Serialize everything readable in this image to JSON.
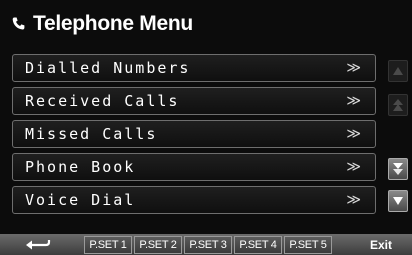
{
  "header": {
    "icon": "phone-icon",
    "title": "Telephone Menu"
  },
  "menu": {
    "items": [
      {
        "label": "Dialled Numbers",
        "arrow": "≫"
      },
      {
        "label": "Received Calls",
        "arrow": "≫"
      },
      {
        "label": "Missed Calls",
        "arrow": "≫"
      },
      {
        "label": "Phone Book",
        "arrow": "≫"
      },
      {
        "label": "Voice Dial",
        "arrow": "≫"
      }
    ]
  },
  "scroll": {
    "buttons": [
      {
        "icon": "scroll-top-icon",
        "state": "disabled"
      },
      {
        "icon": "page-up-icon",
        "state": "disabled"
      },
      {
        "icon": "page-down-icon",
        "state": "enabled"
      },
      {
        "icon": "scroll-bottom-icon",
        "state": "enabled"
      }
    ]
  },
  "bottom_bar": {
    "back_icon": "back-arrow-icon",
    "presets": [
      "P.SET 1",
      "P.SET 2",
      "P.SET 3",
      "P.SET 4",
      "P.SET 5"
    ],
    "exit_label": "Exit"
  },
  "colors": {
    "background": "#0c0c0c",
    "item_border": "#6e6e6e",
    "text": "#ffffff",
    "bottom_bar": "#5a5a5a"
  }
}
